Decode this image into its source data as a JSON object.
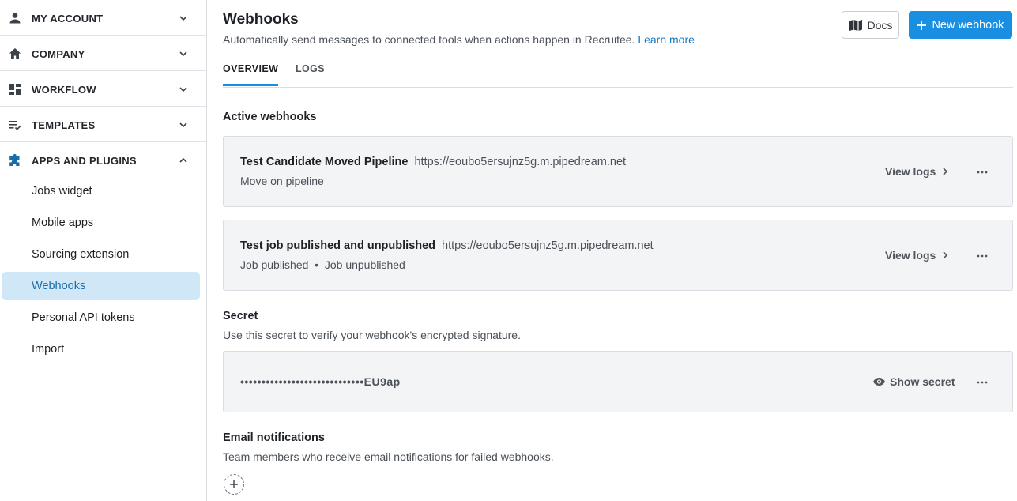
{
  "sidebar": {
    "sections": [
      {
        "label": "MY ACCOUNT",
        "icon": "person-icon"
      },
      {
        "label": "COMPANY",
        "icon": "home-icon"
      },
      {
        "label": "WORKFLOW",
        "icon": "dashboard-icon"
      },
      {
        "label": "TEMPLATES",
        "icon": "checklist-icon"
      },
      {
        "label": "APPS AND PLUGINS",
        "icon": "puzzle-icon"
      }
    ],
    "items": [
      {
        "label": "Jobs widget"
      },
      {
        "label": "Mobile apps"
      },
      {
        "label": "Sourcing extension"
      },
      {
        "label": "Webhooks"
      },
      {
        "label": "Personal API tokens"
      },
      {
        "label": "Import"
      }
    ]
  },
  "header": {
    "title": "Webhooks",
    "subtitle": "Automatically send messages to connected tools when actions happen in Recruitee.",
    "learn_more": "Learn more",
    "docs_label": "Docs",
    "new_label": "New webhook"
  },
  "tabs": [
    {
      "label": "OVERVIEW"
    },
    {
      "label": "LOGS"
    }
  ],
  "active_webhooks": {
    "heading": "Active webhooks",
    "items": [
      {
        "name": "Test Candidate Moved Pipeline",
        "url": "https://eoubo5ersujnz5g.m.pipedream.net",
        "events": "Move on pipeline",
        "view_logs": "View logs"
      },
      {
        "name": "Test job published and unpublished",
        "url": "https://eoubo5ersujnz5g.m.pipedream.net",
        "events": "Job published  •  Job unpublished",
        "view_logs": "View logs"
      }
    ]
  },
  "secret": {
    "heading": "Secret",
    "description": "Use this secret to verify your webhook's encrypted signature.",
    "masked_value": "•••••••••••••••••••••••••••••EU9ap",
    "show_label": "Show secret"
  },
  "email_notifications": {
    "heading": "Email notifications",
    "description": "Team members who receive email notifications for failed webhooks."
  },
  "colors": {
    "accent": "#1a8ee0",
    "active_item_bg": "#cfe7f7",
    "card_bg": "#f3f4f6"
  }
}
